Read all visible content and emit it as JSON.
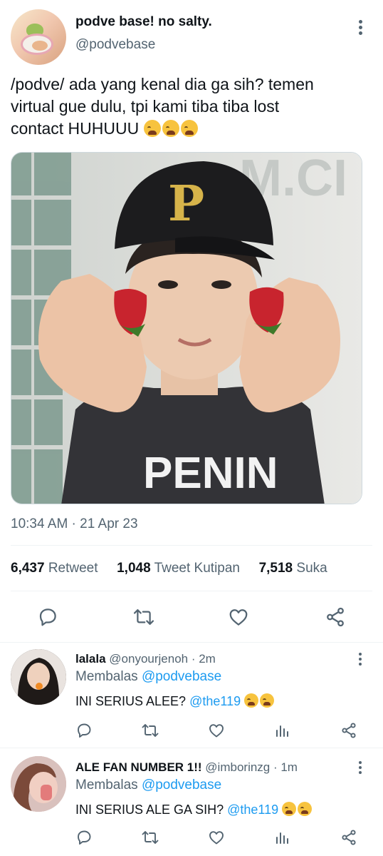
{
  "tweet": {
    "author": {
      "display_name": "podve base! no salty.",
      "handle": "@podvebase"
    },
    "text_line1": "/podve/ ada yang kenal dia ga sih? temen",
    "text_line2": "virtual gue dulu, tpi kami tiba tiba lost",
    "text_line3": "contact HUHUUU",
    "text_emojis": [
      "loudly-crying-face",
      "loudly-crying-face",
      "loudly-crying-face"
    ],
    "photo_description_icon": "photo",
    "timestamp": "10:34 AM · 21 Apr 23",
    "stats": {
      "retweets_count": "6,437",
      "retweets_label": "Retweet",
      "quotes_count": "1,048",
      "quotes_label": "Tweet Kutipan",
      "likes_count": "7,518",
      "likes_label": "Suka"
    },
    "actions": [
      "reply-icon",
      "retweet-icon",
      "like-icon",
      "share-icon"
    ]
  },
  "replies": [
    {
      "display_name": "lalala",
      "handle_time": "@onyourjenoh · 2m",
      "replying_label": "Membalas",
      "replying_to": "@podvebase",
      "text": "INI SERIUS ALEE?",
      "mention": "@the119",
      "emojis": [
        "loudly-crying-face",
        "loudly-crying-face"
      ]
    },
    {
      "display_name": "ALE FAN NUMBER 1!!",
      "handle_time": "@imborinzg · 1m",
      "replying_label": "Membalas",
      "replying_to": "@podvebase",
      "text": "INI SERIUS ALE GA SIH?",
      "mention": "@the119",
      "emojis": [
        "loudly-crying-face",
        "loudly-crying-face"
      ]
    }
  ],
  "colors": {
    "accent": "#1d9bf0",
    "text": "#0f1419",
    "secondary": "#536471",
    "divider": "#eff3f4"
  }
}
